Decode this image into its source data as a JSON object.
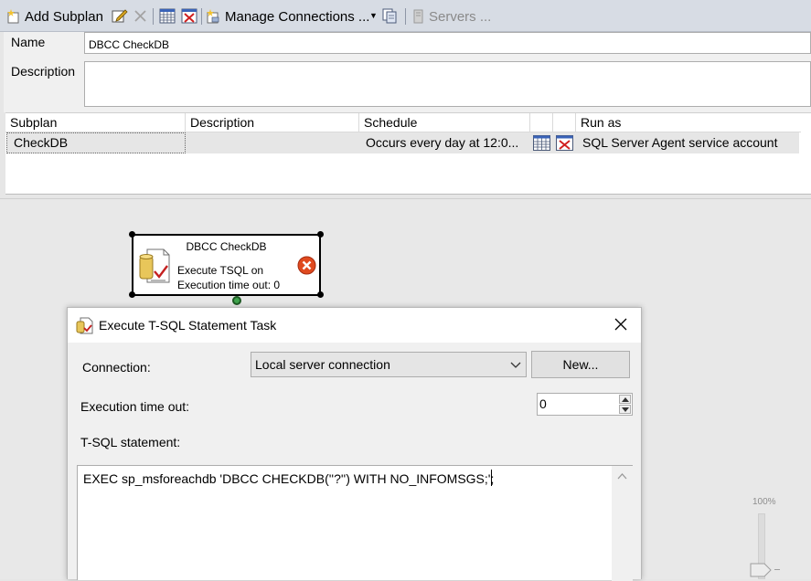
{
  "toolbar": {
    "add_subplan": "Add Subplan",
    "manage_connections": "Manage Connections ...",
    "servers": "Servers ..."
  },
  "props": {
    "name_label": "Name",
    "name_value": "DBCC CheckDB",
    "description_label": "Description",
    "description_value": ""
  },
  "grid": {
    "headers": [
      "Subplan",
      "Description",
      "Schedule",
      "Run as"
    ],
    "row": {
      "subplan": "CheckDB",
      "description": "",
      "schedule": "Occurs every day at 12:0...",
      "run_as": "SQL Server Agent service account"
    }
  },
  "task": {
    "title": "DBCC CheckDB",
    "line1": "Execute TSQL on",
    "line2": "Execution time out: 0"
  },
  "dialog": {
    "title": "Execute T-SQL Statement Task",
    "connection_label": "Connection:",
    "connection_value": "Local server connection",
    "new_button": "New...",
    "timeout_label": "Execution time out:",
    "timeout_value": "0",
    "tsql_label": "T-SQL statement:",
    "tsql_value": "EXEC sp_msforeachdb 'DBCC CHECKDB(''?'') WITH NO_INFOMSGS;';"
  },
  "zoom": {
    "label": "100%"
  },
  "colors": {
    "toolbar_bg": "#d7dce4",
    "error_red": "#e04a1f",
    "handle_green": "#3fa34d"
  }
}
